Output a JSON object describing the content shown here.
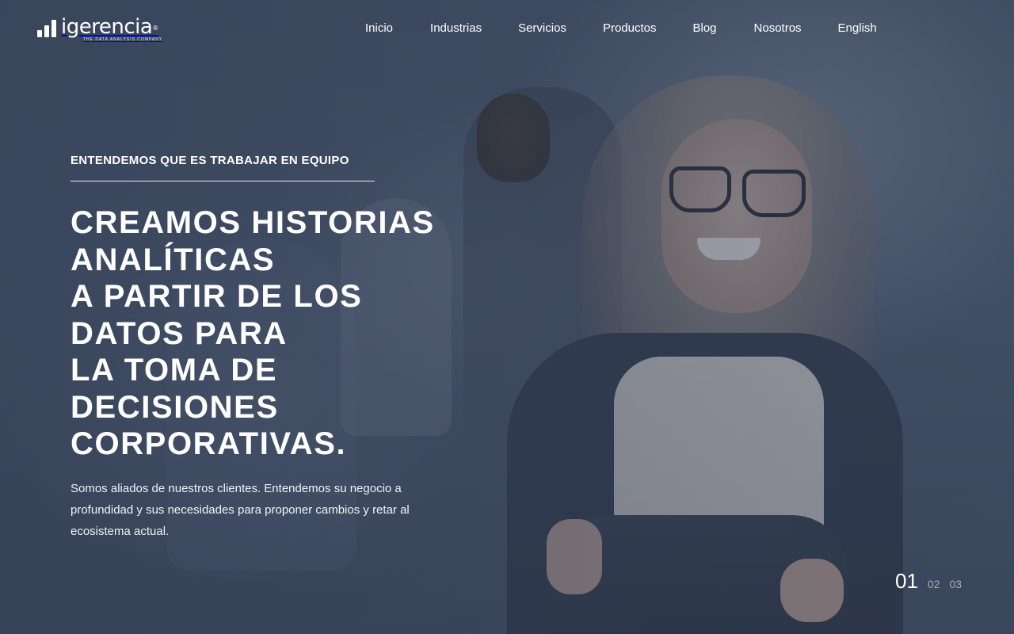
{
  "brand": {
    "name": "igerencia",
    "registered_mark": "®",
    "tagline": "THE DATA ANALYSIS COMPANY"
  },
  "nav": {
    "items": [
      "Inicio",
      "Industrias",
      "Servicios",
      "Productos",
      "Blog",
      "Nosotros",
      "English"
    ]
  },
  "hero": {
    "kicker": "ENTENDEMOS QUE ES TRABAJAR EN EQUIPO",
    "headline_lines": [
      "CREAMOS HISTORIAS",
      "ANALÍTICAS",
      "A PARTIR DE LOS",
      "DATOS PARA",
      "LA TOMA DE",
      "DECISIONES",
      "CORPORATIVAS."
    ],
    "description": "Somos aliados de nuestros clientes. Entendemos su negocio a profundidad y sus necesidades para proponer cambios y retar al ecosistema actual."
  },
  "slider": {
    "active": "01",
    "others": [
      "02",
      "03"
    ]
  },
  "colors": {
    "overlay": "#344056",
    "text": "#ffffff"
  }
}
